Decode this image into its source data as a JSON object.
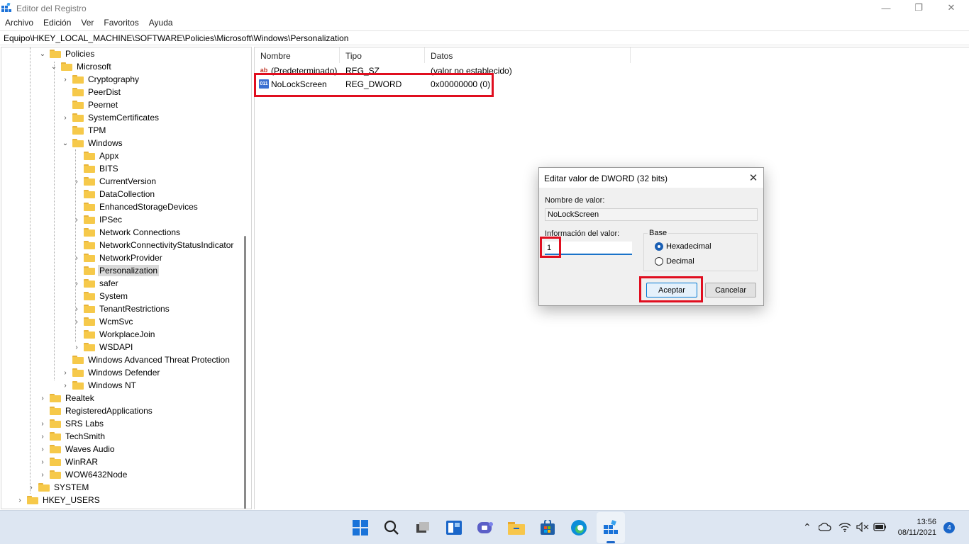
{
  "window": {
    "title": "Editor del Registro"
  },
  "menu": [
    "Archivo",
    "Edición",
    "Ver",
    "Favoritos",
    "Ayuda"
  ],
  "address": "Equipo\\HKEY_LOCAL_MACHINE\\SOFTWARE\\Policies\\Microsoft\\Windows\\Personalization",
  "tree": [
    {
      "label": "Policies",
      "expanded": true
    },
    {
      "label": "Microsoft",
      "expanded": true
    },
    {
      "label": "Cryptography"
    },
    {
      "label": "PeerDist"
    },
    {
      "label": "Peernet"
    },
    {
      "label": "SystemCertificates"
    },
    {
      "label": "TPM"
    },
    {
      "label": "Windows",
      "expanded": true
    },
    {
      "label": "Appx"
    },
    {
      "label": "BITS"
    },
    {
      "label": "CurrentVersion"
    },
    {
      "label": "DataCollection"
    },
    {
      "label": "EnhancedStorageDevices"
    },
    {
      "label": "IPSec"
    },
    {
      "label": "Network Connections"
    },
    {
      "label": "NetworkConnectivityStatusIndicator"
    },
    {
      "label": "NetworkProvider"
    },
    {
      "label": "Personalization",
      "selected": true
    },
    {
      "label": "safer"
    },
    {
      "label": "System"
    },
    {
      "label": "TenantRestrictions"
    },
    {
      "label": "WcmSvc"
    },
    {
      "label": "WorkplaceJoin"
    },
    {
      "label": "WSDAPI"
    },
    {
      "label": "Windows Advanced Threat Protection"
    },
    {
      "label": "Windows Defender"
    },
    {
      "label": "Windows NT"
    },
    {
      "label": "Realtek"
    },
    {
      "label": "RegisteredApplications"
    },
    {
      "label": "SRS Labs"
    },
    {
      "label": "TechSmith"
    },
    {
      "label": "Waves Audio"
    },
    {
      "label": "WinRAR"
    },
    {
      "label": "WOW6432Node"
    },
    {
      "label": "SYSTEM"
    },
    {
      "label": "HKEY_USERS"
    }
  ],
  "list": {
    "columns": [
      "Nombre",
      "Tipo",
      "Datos"
    ],
    "rows": [
      {
        "icon": "string-value-icon",
        "icon_text": "ab",
        "name": "(Predeterminado)",
        "type": "REG_SZ",
        "data": "(valor no establecido)"
      },
      {
        "icon": "binary-value-icon",
        "icon_text": "011",
        "name": "NoLockScreen",
        "type": "REG_DWORD",
        "data": "0x00000000 (0)"
      }
    ]
  },
  "dialog": {
    "title": "Editar valor de DWORD (32 bits)",
    "value_name_label": "Nombre de valor:",
    "value_name": "NoLockScreen",
    "value_data_label": "Información del valor:",
    "value_data": "1",
    "base_label": "Base",
    "base_options": [
      "Hexadecimal",
      "Decimal"
    ],
    "base_selected": "Hexadecimal",
    "ok_label": "Aceptar",
    "cancel_label": "Cancelar"
  },
  "taskbar": {
    "time": "13:56",
    "date": "08/11/2021",
    "notifications": "4"
  },
  "colors": {
    "highlight": "#e00e1f",
    "accent": "#0078d4",
    "folder": "#f6c94a"
  }
}
